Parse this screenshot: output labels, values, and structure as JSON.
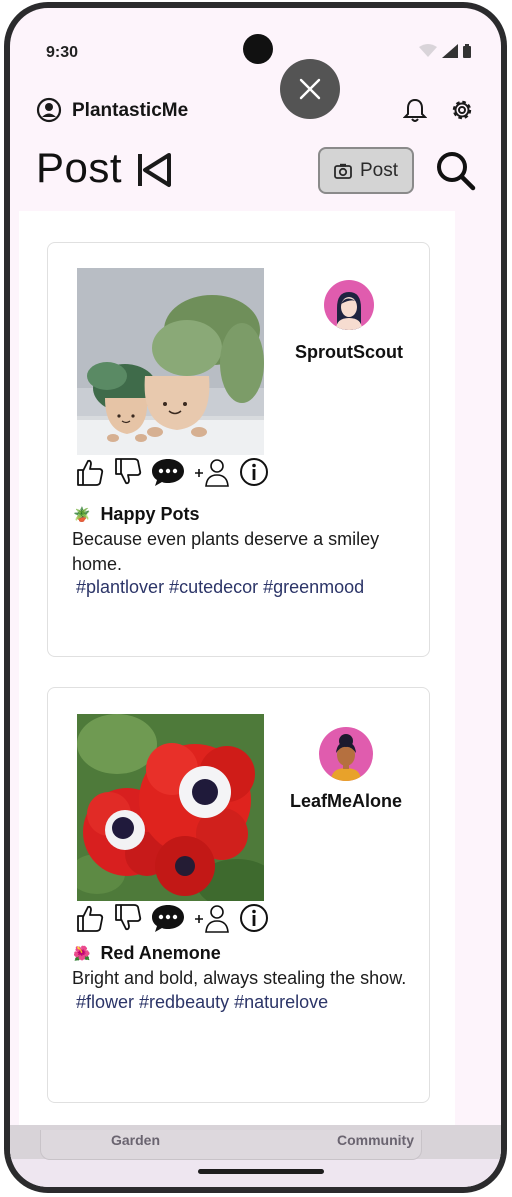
{
  "status_bar": {
    "time": "9:30"
  },
  "header": {
    "app_name": "PlantasticMe",
    "page_title": "Post",
    "post_button_label": "Post"
  },
  "posts": [
    {
      "username": "SproutScout",
      "title_emoji": "🪴",
      "title": "Happy Pots",
      "description": "Because even plants deserve a smiley home.",
      "tags": "#plantlover #cutedecor #greenmood"
    },
    {
      "username": "LeafMeAlone",
      "title_emoji": "🌺",
      "title": "Red Anemone",
      "description": "Bright and bold, always stealing the show.",
      "tags": "#flower #redbeauty #naturelove"
    }
  ],
  "bottom_nav": {
    "tab_left": "Garden",
    "tab_right": "Community"
  },
  "colors": {
    "screen_bg": "#fdf4fb",
    "avatar": "#e05cae",
    "tags": "#2c3568",
    "close_fab": "#545454"
  }
}
